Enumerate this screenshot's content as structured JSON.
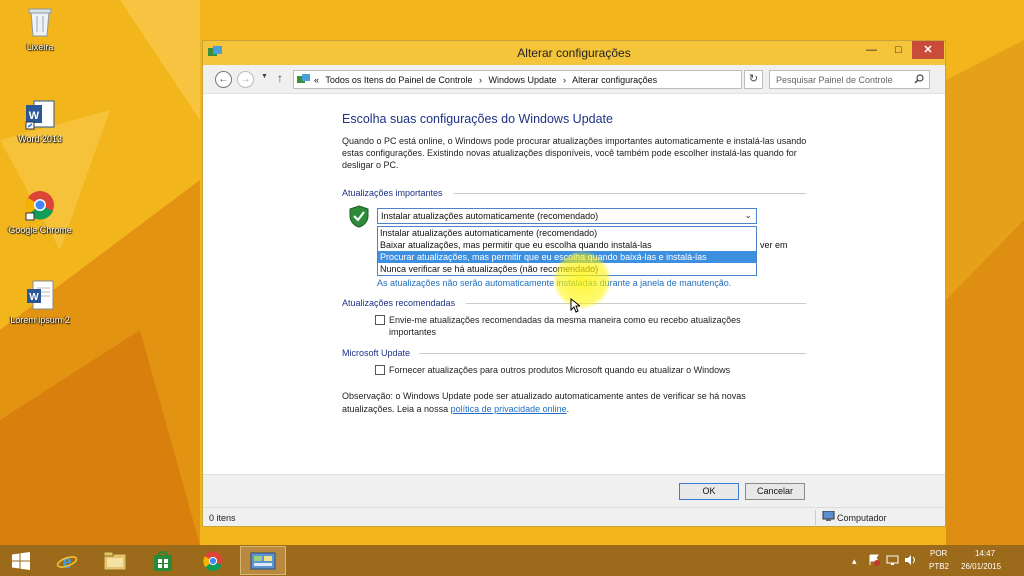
{
  "desktop": {
    "icons": [
      {
        "label": "Lixeira",
        "icon": "recycle-bin-icon"
      },
      {
        "label": "Word 2013",
        "icon": "word-icon"
      },
      {
        "label": "Google Chrome",
        "icon": "chrome-icon"
      },
      {
        "label": "Lorem ipsum 2",
        "icon": "word-document-icon"
      }
    ]
  },
  "window": {
    "title": "Alterar configurações",
    "controls": {
      "minimize": "—",
      "maximize": "□",
      "close": "✕"
    },
    "breadcrumb": [
      "«",
      "Todos os Itens do Painel de Controle",
      "›",
      "Windows Update",
      "›",
      "Alterar configurações"
    ],
    "search_placeholder": "Pesquisar Painel de Controle",
    "content": {
      "heading": "Escolha suas configurações do Windows Update",
      "intro": "Quando o PC está online, o Windows pode procurar atualizações importantes automaticamente e instalá-las usando estas configurações. Existindo novas atualizações disponíveis, você também pode escolher instalá-las quando for desligar o PC.",
      "important_section": "Atualizações importantes",
      "combo_selected": "Instalar atualizações automaticamente (recomendado)",
      "options": [
        "Instalar atualizações automaticamente (recomendado)",
        "Baixar atualizações, mas permitir que eu escolha quando instalá-las",
        "Procurar atualizações, mas permitir que eu escolha quando baixá-las e instalá-las",
        "Nunca verificar se há atualizações (não recomendado)"
      ],
      "selected_option_index": 2,
      "behind_text": "ver em",
      "maintenance_note": "As atualizações não serão automaticamente instaladas durante a janela de manutenção.",
      "recommended_section": "Atualizações recomendadas",
      "recommended_checkbox": "Envie-me atualizações recomendadas da mesma maneira como eu recebo atualizações importantes",
      "recommended_checked": false,
      "microsoft_section": "Microsoft Update",
      "microsoft_checkbox": "Fornecer atualizações para outros produtos Microsoft quando eu atualizar o Windows",
      "microsoft_checked": false,
      "observation_prefix": "Observação: o Windows Update pode ser atualizado automaticamente antes de verificar se há novas atualizações. Leia a nossa ",
      "observation_link": "política de privacidade online",
      "observation_suffix": "."
    },
    "buttons": {
      "ok": "OK",
      "cancel": "Cancelar"
    },
    "status": {
      "items": "0 itens",
      "location": "Computador"
    }
  },
  "taskbar": {
    "apps": [
      "start-button",
      "internet-explorer-icon",
      "file-explorer-icon",
      "store-icon",
      "chrome-icon",
      "control-panel-icon"
    ],
    "language": "POR",
    "layout": "PTB2",
    "time": "14:47",
    "date": "26/01/2015",
    "tray_chevron": "▴"
  },
  "colors": {
    "desktop": "#f3b51c",
    "titlebar": "#f4c53a",
    "heading": "#1e3287",
    "link": "#1f6dbf",
    "selection": "#3d8fe0",
    "taskbar": "#9c6a1b"
  }
}
